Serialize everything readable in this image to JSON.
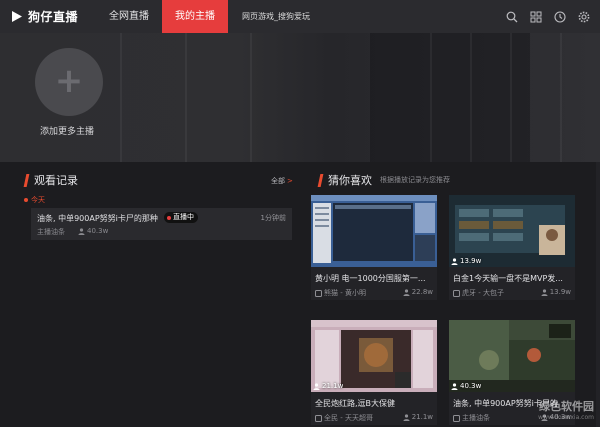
{
  "app": {
    "logo_text": "狗仔直播"
  },
  "nav": {
    "tabs": [
      {
        "label": "全网直播"
      },
      {
        "label": "我的主播"
      },
      {
        "label": "网页游戏_搜狗爱玩"
      }
    ]
  },
  "hero": {
    "add_label": "添加更多主播"
  },
  "history": {
    "title": "观看记录",
    "all_link": "全部",
    "today_label": "今天",
    "item": {
      "title": "油条, 中单900AP努努i卡尸的那种",
      "live_badge": "直播中",
      "time": "1分钟前",
      "author": "主播油条",
      "count": "40.3w"
    }
  },
  "recommend": {
    "title": "猜你喜欢",
    "subtitle": "根据播放记录为您推荐",
    "cards": [
      {
        "title": "黄小明 电一1000分国服第一...",
        "author": "熊猫 - 黄小明",
        "count": "22.8w",
        "views": ""
      },
      {
        "title": "白金1今天输一盘不是MVP发...",
        "author": "虎牙 - 大包子",
        "count": "13.9w",
        "views": "13.9w"
      },
      {
        "title": "全民炮红路,逗B大保健",
        "author": "全民 - 天天超哥",
        "count": "21.1w",
        "views": "21.1w"
      },
      {
        "title": "油条, 中单900AP努努i卡尸的",
        "author": "主播油条",
        "count": "40.3w",
        "views": "40.3w"
      }
    ]
  },
  "watermark": {
    "text": "绿色软件园",
    "url": "www.downxia.com"
  },
  "colors": {
    "accent": "#e63d3d",
    "section_bar": "#e84b2f",
    "background": "#1c1c1f",
    "topbar": "#2b2b2f"
  }
}
